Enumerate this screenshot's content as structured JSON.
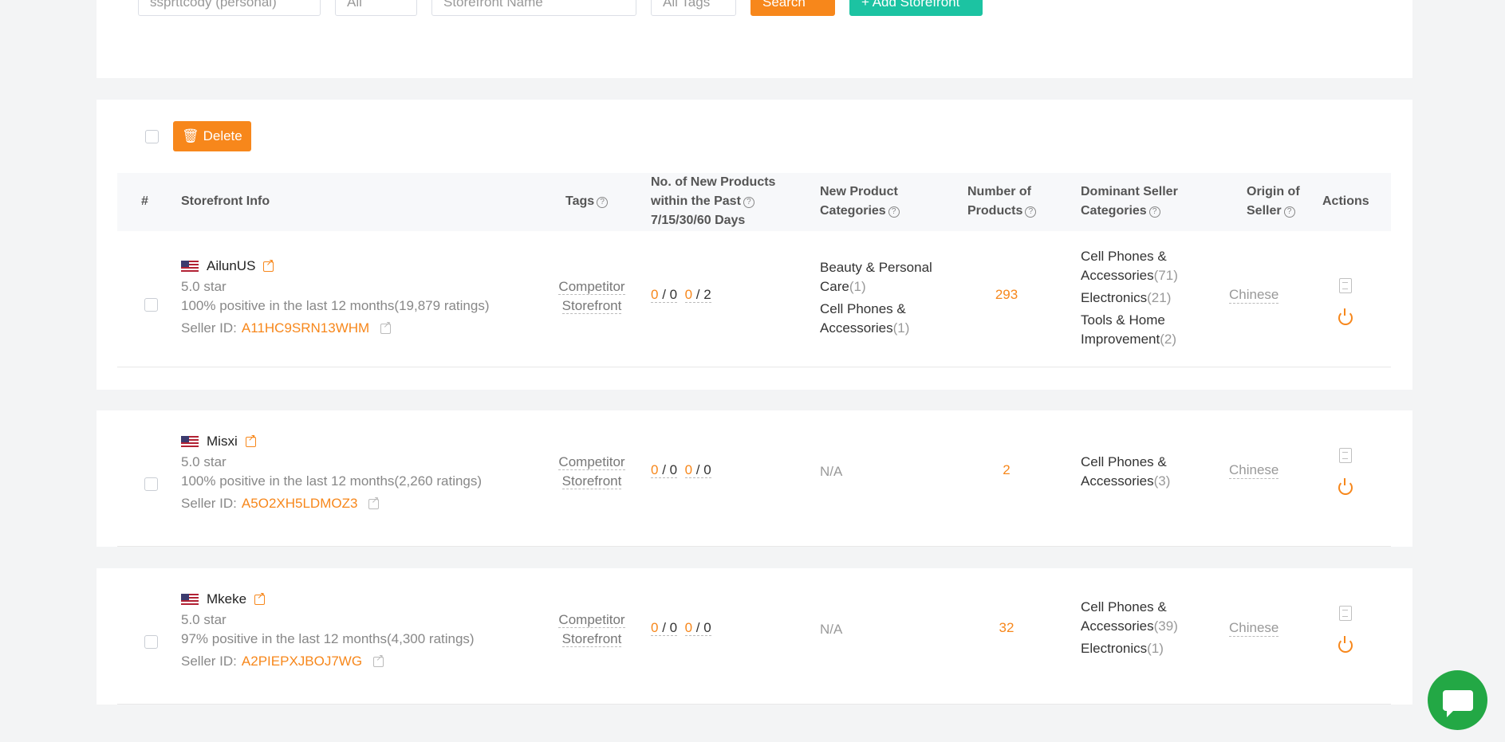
{
  "filters": {
    "account": "ssprttcody (personal)",
    "marketplace": "All",
    "storefront_placeholder": "Storefront Name",
    "tags": "All Tags",
    "search_label": "Search",
    "add_label": "+ Add Storefront"
  },
  "toolbar": {
    "delete_label": "Delete"
  },
  "table": {
    "headers": {
      "index": "#",
      "storefront": "Storefront Info",
      "tags": "Tags",
      "new_products_l1": "No. of New Products",
      "new_products_l2": "within the Past",
      "new_products_l3": "7/15/30/60 Days",
      "new_cats_l1": "New Product",
      "new_cats_l2": "Categories",
      "num_products_l1": "Number of",
      "num_products_l2": "Products",
      "dominant_l1": "Dominant Seller",
      "dominant_l2": "Categories",
      "origin_l1": "Origin of",
      "origin_l2": "Seller",
      "actions": "Actions"
    },
    "rows": [
      {
        "name": "AilunUS",
        "stars": "5.0 star",
        "positive": "100% positive  in the last 12 months(19,879 ratings)",
        "seller_label": "Seller ID:",
        "seller_id": "A11HC9SRN13WHM",
        "tag_l1": "Competitor",
        "tag_l2": "Storefront",
        "d7": "0",
        "d15": "0",
        "d30": "0",
        "d60": "2",
        "new_cat1": "Beauty & Personal Care",
        "new_cat1_count": "(1)",
        "new_cat2": "Cell Phones & Accessories",
        "new_cat2_count": "(1)",
        "products": "293",
        "dom1": "Cell Phones & Accessories",
        "dom1_count": "(71)",
        "dom2": "Electronics",
        "dom2_count": "(21)",
        "dom3": "Tools & Home Improvement",
        "dom3_count": "(2)",
        "origin": "Chinese"
      },
      {
        "name": "Misxi",
        "stars": "5.0 star",
        "positive": "100% positive  in the last 12 months(2,260 ratings)",
        "seller_label": "Seller ID:",
        "seller_id": "A5O2XH5LDMOZ3",
        "tag_l1": "Competitor",
        "tag_l2": "Storefront",
        "d7": "0",
        "d15": "0",
        "d30": "0",
        "d60": "0",
        "new_cat": "N/A",
        "products": "2",
        "dom1": "Cell Phones & Accessories",
        "dom1_count": "(3)",
        "origin": "Chinese"
      },
      {
        "name": "Mkeke",
        "stars": "5.0 star",
        "positive": "97% positive  in the last 12 months(4,300 ratings)",
        "seller_label": "Seller ID:",
        "seller_id": "A2PIEPXJBOJ7WG",
        "tag_l1": "Competitor",
        "tag_l2": "Storefront",
        "d7": "0",
        "d15": "0",
        "d30": "0",
        "d60": "0",
        "new_cat": "N/A",
        "products": "32",
        "dom1": "Cell Phones & Accessories",
        "dom1_count": "(39)",
        "dom2": "Electronics",
        "dom2_count": "(1)",
        "origin": "Chinese"
      }
    ]
  },
  "colors": {
    "accent": "#f7871b",
    "add": "#1cc3a2",
    "chat": "#23a845"
  }
}
